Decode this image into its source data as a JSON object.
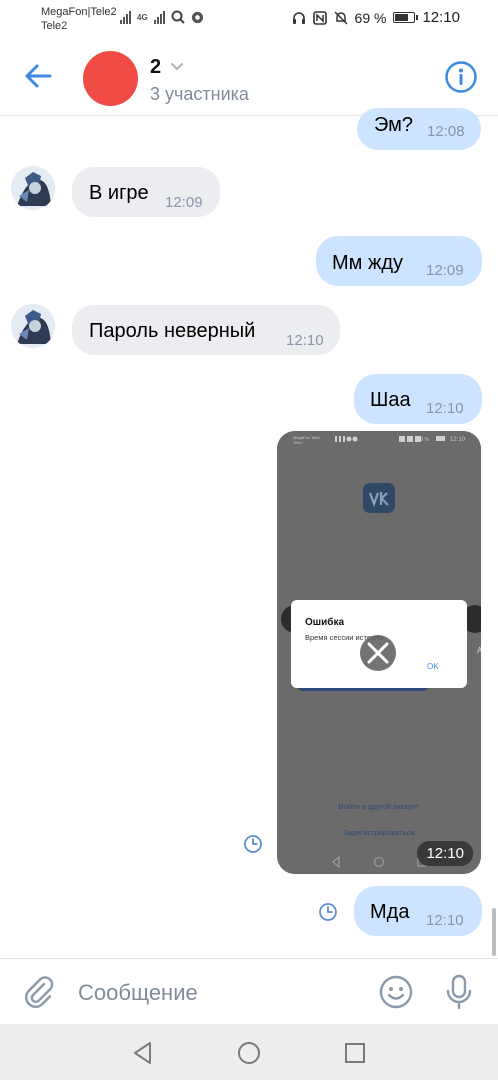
{
  "status_bar": {
    "carrier_line1": "MegaFon|Tele2",
    "carrier_line2": "Tele2",
    "network": "4G",
    "battery": "69 %",
    "time": "12:10"
  },
  "header": {
    "title": "2",
    "subtitle": "3 участника",
    "avatar_color": "#ef4b44",
    "accent_color": "#3f8ae0"
  },
  "messages": [
    {
      "direction": "out",
      "text": "Эм?",
      "time": "12:08"
    },
    {
      "direction": "in",
      "text": "В игре",
      "time": "12:09"
    },
    {
      "direction": "out",
      "text": "Мм жду",
      "time": "12:09"
    },
    {
      "direction": "in",
      "text": "Пароль неверный",
      "time": "12:10"
    },
    {
      "direction": "out",
      "text": "Шаа",
      "time": "12:10"
    },
    {
      "direction": "out",
      "type": "image",
      "time": "12:10",
      "status": "sending"
    },
    {
      "direction": "out",
      "text": "Мда",
      "time": "12:10",
      "status": "sending"
    }
  ],
  "screenshot_content": {
    "status_time": "12:10",
    "status_battery": "69 %",
    "dialog_title": "Ошибка",
    "dialog_text": "Время сессии истекло",
    "dialog_ok": "OK",
    "link_other_account": "Войти в другой аккаунт",
    "link_register": "Зарегистрироваться"
  },
  "composer": {
    "placeholder": "Сообщение"
  }
}
